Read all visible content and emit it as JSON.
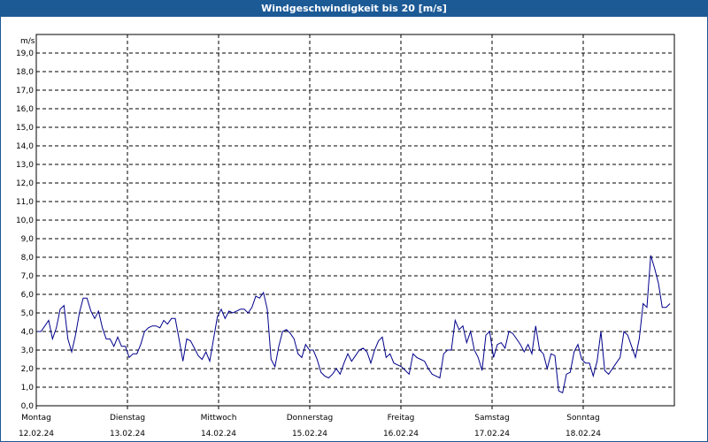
{
  "window": {
    "title": "Windgeschwindigkeit bis 20 [m/s]"
  },
  "colors": {
    "title_bar": "#1c5a96",
    "series_line": "#00008b",
    "grid": "#000000"
  },
  "chart_data": {
    "type": "line",
    "title": "Windgeschwindigkeit bis 20 [m/s]",
    "ylabel": "m/s",
    "ylim": [
      0,
      20
    ],
    "yticks": [
      "0,0",
      "1,0",
      "2,0",
      "3,0",
      "4,0",
      "5,0",
      "6,0",
      "7,0",
      "8,0",
      "9,0",
      "10,0",
      "11,0",
      "12,0",
      "13,0",
      "14,0",
      "15,0",
      "16,0",
      "17,0",
      "18,0",
      "19,0"
    ],
    "days": [
      {
        "name": "Montag",
        "date": "12.02.24"
      },
      {
        "name": "Dienstag",
        "date": "13.02.24"
      },
      {
        "name": "Mittwoch",
        "date": "14.02.24"
      },
      {
        "name": "Donnerstag",
        "date": "15.02.24"
      },
      {
        "name": "Freitag",
        "date": "16.02.24"
      },
      {
        "name": "Samstag",
        "date": "17.02.24"
      },
      {
        "name": "Sonntag",
        "date": "18.02.24"
      }
    ],
    "grid": true,
    "series": [
      {
        "values": [
          4.0,
          4.0,
          4.3,
          4.6,
          3.6,
          4.2,
          5.2,
          5.4,
          3.6,
          2.9,
          3.8,
          5.0,
          5.8,
          5.8,
          5.1,
          4.7,
          5.1,
          4.2,
          3.6,
          3.6,
          3.2,
          3.7,
          3.2,
          3.2,
          2.6,
          2.8,
          2.8,
          3.3,
          4.0,
          4.2,
          4.3,
          4.3,
          4.2,
          4.6,
          4.4,
          4.7,
          4.7,
          3.6,
          2.4,
          3.6,
          3.5,
          3.1,
          2.7,
          2.5,
          2.9,
          2.4,
          3.6,
          4.8,
          5.2,
          4.7,
          5.1,
          5.0,
          5.1,
          5.2,
          5.2,
          5.0,
          5.3,
          5.9,
          5.8,
          6.1,
          5.2,
          2.5,
          2.1,
          3.2,
          4.0,
          4.1,
          3.9,
          3.6,
          2.8,
          2.6,
          3.3,
          3.0,
          3.0,
          2.5,
          1.8,
          1.6,
          1.5,
          1.7,
          2.0,
          1.7,
          2.3,
          2.8,
          2.4,
          2.7,
          3.0,
          3.1,
          2.9,
          2.3,
          3.0,
          3.5,
          3.7,
          2.6,
          2.8,
          2.3,
          2.2,
          2.1,
          1.9,
          1.7,
          2.8,
          2.6,
          2.5,
          2.4,
          2.0,
          1.7,
          1.6,
          1.5,
          2.8,
          3.0,
          3.0,
          4.6,
          4.1,
          4.3,
          3.4,
          4.0,
          3.0,
          2.6,
          1.9,
          3.8,
          4.0,
          2.6,
          3.3,
          3.4,
          3.1,
          4.0,
          3.9,
          3.6,
          3.3,
          2.9,
          3.3,
          2.8,
          4.3,
          3.0,
          2.8,
          2.0,
          2.8,
          2.7,
          0.8,
          0.7,
          1.7,
          1.8,
          2.9,
          3.3,
          2.5,
          2.3,
          2.3,
          1.6,
          2.4,
          4.0,
          1.9,
          1.7,
          2.0,
          2.3,
          2.6,
          4.0,
          3.8,
          3.2,
          2.6,
          3.6,
          5.5,
          5.3,
          8.1,
          7.4,
          6.6,
          5.3,
          5.3,
          5.5
        ]
      }
    ]
  }
}
